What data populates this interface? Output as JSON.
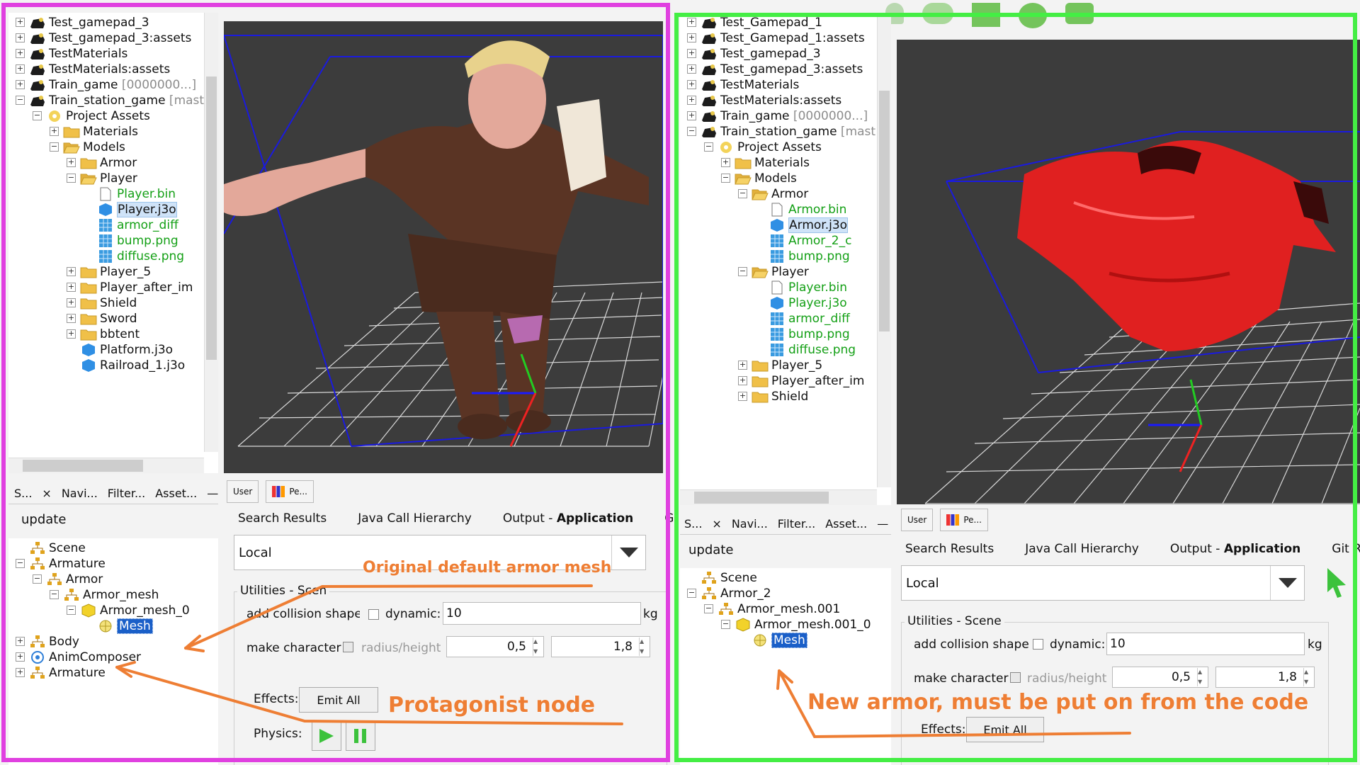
{
  "left": {
    "tree_rows": [
      {
        "label": "Test_gamepad_3",
        "icon": "gamepad-project-icon",
        "indent": 0,
        "expander": "+"
      },
      {
        "label": "Test_gamepad_3:assets",
        "icon": "gamepad-project-icon",
        "indent": 0,
        "expander": "+"
      },
      {
        "label": "TestMaterials",
        "icon": "gamepad-project-icon",
        "indent": 0,
        "expander": "+"
      },
      {
        "label": "TestMaterials:assets",
        "icon": "gamepad-project-icon",
        "indent": 0,
        "expander": "+"
      },
      {
        "label": "Train_game",
        "gray": " [0000000...]",
        "icon": "gamepad-project-icon",
        "indent": 0,
        "expander": "+"
      },
      {
        "label": "Train_station_game",
        "gray": " [mast",
        "icon": "gamepad-project-icon",
        "indent": 0,
        "expander": "-"
      },
      {
        "label": "Project Assets",
        "icon": "assets-icon",
        "indent": 1,
        "expander": "-"
      },
      {
        "label": "Materials",
        "icon": "folder-icon",
        "indent": 2,
        "expander": "+"
      },
      {
        "label": "Models",
        "icon": "folder-open-icon",
        "indent": 2,
        "expander": "-"
      },
      {
        "label": "Armor",
        "icon": "folder-icon",
        "indent": 3,
        "expander": "+"
      },
      {
        "label": "Player",
        "icon": "folder-open-icon",
        "indent": 3,
        "expander": "-"
      },
      {
        "label": "Player.bin",
        "icon": "file-icon",
        "indent": 4,
        "expander": "",
        "green": true
      },
      {
        "label": "Player.j3o",
        "icon": "model-cube-icon",
        "indent": 4,
        "expander": "",
        "selected": true
      },
      {
        "label": "armor_diff",
        "icon": "image-file-icon",
        "indent": 4,
        "expander": "",
        "green": true
      },
      {
        "label": "bump.png",
        "icon": "image-file-icon",
        "indent": 4,
        "expander": "",
        "green": true
      },
      {
        "label": "diffuse.png",
        "icon": "image-file-icon",
        "indent": 4,
        "expander": "",
        "green": true
      },
      {
        "label": "Player_5",
        "icon": "folder-icon",
        "indent": 3,
        "expander": "+"
      },
      {
        "label": "Player_after_im",
        "icon": "folder-icon",
        "indent": 3,
        "expander": "+"
      },
      {
        "label": "Shield",
        "icon": "folder-icon",
        "indent": 3,
        "expander": "+"
      },
      {
        "label": "Sword",
        "icon": "folder-icon",
        "indent": 3,
        "expander": "+"
      },
      {
        "label": "bbtent",
        "icon": "folder-icon",
        "indent": 3,
        "expander": "+"
      },
      {
        "label": "Platform.j3o",
        "icon": "model-cube-icon",
        "indent": 3,
        "expander": ""
      },
      {
        "label": "Railroad_1.j3o",
        "icon": "model-cube-icon",
        "indent": 3,
        "expander": ""
      }
    ],
    "panel_tabs": [
      "S...",
      "×",
      "Navi...",
      "Filter...",
      "Asset...",
      "—"
    ],
    "update_label": "update",
    "scene_rows": [
      {
        "label": "Scene",
        "icon": "scene-node-icon",
        "indent": 0,
        "expander": ""
      },
      {
        "label": "Armature",
        "icon": "node-icon",
        "indent": 0,
        "expander": "-"
      },
      {
        "label": "Armor",
        "icon": "node-icon",
        "indent": 1,
        "expander": "-"
      },
      {
        "label": "Armor_mesh",
        "icon": "node-icon",
        "indent": 2,
        "expander": "-"
      },
      {
        "label": "Armor_mesh_0",
        "icon": "geometry-cube-icon",
        "indent": 3,
        "expander": "-"
      },
      {
        "label": "Mesh",
        "icon": "mesh-icon",
        "indent": 4,
        "expander": "",
        "selected": true
      },
      {
        "label": "Body",
        "icon": "node-icon",
        "indent": 0,
        "expander": "+"
      },
      {
        "label": "AnimComposer",
        "icon": "anim-control-icon",
        "indent": 0,
        "expander": "+"
      },
      {
        "label": "Armature",
        "icon": "skeleton-icon",
        "indent": 0,
        "expander": "+"
      }
    ],
    "toolbar": {
      "user_label": "User",
      "pe_label": "Pe..."
    },
    "output_tabs": [
      "Search Results",
      "Java Call Hierarchy",
      "Output - ",
      "Git"
    ],
    "output_app": "Application",
    "combo_value": "Local",
    "utilities_title": "Utilities - Scen",
    "collision_label": "add collision shape",
    "dynamic_label": "dynamic:",
    "dynamic_value": "10",
    "kg": "kg",
    "make_character": "make character",
    "radius_label": "radius/height",
    "radius_value": "0,5",
    "height_value": "1,8",
    "effects_label": "Effects:",
    "emit_all": "Emit All",
    "physics_label": "Physics:"
  },
  "right": {
    "tree_rows": [
      {
        "label": "Test_Gamepad_1",
        "icon": "gamepad-project-icon",
        "indent": 0,
        "expander": "+"
      },
      {
        "label": "Test_Gamepad_1:assets",
        "icon": "gamepad-project-icon",
        "indent": 0,
        "expander": "+"
      },
      {
        "label": "Test_gamepad_3",
        "icon": "gamepad-project-icon",
        "indent": 0,
        "expander": "+"
      },
      {
        "label": "Test_gamepad_3:assets",
        "icon": "gamepad-project-icon",
        "indent": 0,
        "expander": "+"
      },
      {
        "label": "TestMaterials",
        "icon": "gamepad-project-icon",
        "indent": 0,
        "expander": "+"
      },
      {
        "label": "TestMaterials:assets",
        "icon": "gamepad-project-icon",
        "indent": 0,
        "expander": "+"
      },
      {
        "label": "Train_game",
        "gray": " [0000000...]",
        "icon": "gamepad-project-icon",
        "indent": 0,
        "expander": "+"
      },
      {
        "label": "Train_station_game",
        "gray": " [mast",
        "icon": "gamepad-project-icon",
        "indent": 0,
        "expander": "-"
      },
      {
        "label": "Project Assets",
        "icon": "assets-icon",
        "indent": 1,
        "expander": "-"
      },
      {
        "label": "Materials",
        "icon": "folder-icon",
        "indent": 2,
        "expander": "+"
      },
      {
        "label": "Models",
        "icon": "folder-open-icon",
        "indent": 2,
        "expander": "-"
      },
      {
        "label": "Armor",
        "icon": "folder-open-icon",
        "indent": 3,
        "expander": "-"
      },
      {
        "label": "Armor.bin",
        "icon": "file-icon",
        "indent": 4,
        "expander": "",
        "green": true
      },
      {
        "label": "Armor.j3o",
        "icon": "model-cube-icon",
        "indent": 4,
        "expander": "",
        "selected": true
      },
      {
        "label": "Armor_2_c",
        "icon": "image-file-icon",
        "indent": 4,
        "expander": "",
        "green": true
      },
      {
        "label": "bump.png",
        "icon": "image-file-icon",
        "indent": 4,
        "expander": "",
        "green": true
      },
      {
        "label": "Player",
        "icon": "folder-open-icon",
        "indent": 3,
        "expander": "-"
      },
      {
        "label": "Player.bin",
        "icon": "file-icon",
        "indent": 4,
        "expander": "",
        "green": true
      },
      {
        "label": "Player.j3o",
        "icon": "model-cube-icon",
        "indent": 4,
        "expander": "",
        "green": true
      },
      {
        "label": "armor_diff",
        "icon": "image-file-icon",
        "indent": 4,
        "expander": "",
        "green": true
      },
      {
        "label": "bump.png",
        "icon": "image-file-icon",
        "indent": 4,
        "expander": "",
        "green": true
      },
      {
        "label": "diffuse.png",
        "icon": "image-file-icon",
        "indent": 4,
        "expander": "",
        "green": true
      },
      {
        "label": "Player_5",
        "icon": "folder-icon",
        "indent": 3,
        "expander": "+"
      },
      {
        "label": "Player_after_im",
        "icon": "folder-icon",
        "indent": 3,
        "expander": "+"
      },
      {
        "label": "Shield",
        "icon": "folder-icon",
        "indent": 3,
        "expander": "+"
      }
    ],
    "panel_tabs": [
      "S...",
      "×",
      "Navi...",
      "Filter...",
      "Asset...",
      "—"
    ],
    "update_label": "update",
    "scene_rows": [
      {
        "label": "Scene",
        "icon": "scene-node-icon",
        "indent": 0,
        "expander": ""
      },
      {
        "label": "Armor_2",
        "icon": "node-icon",
        "indent": 0,
        "expander": "-"
      },
      {
        "label": "Armor_mesh.001",
        "icon": "node-icon",
        "indent": 1,
        "expander": "-"
      },
      {
        "label": "Armor_mesh.001_0",
        "icon": "geometry-cube-icon",
        "indent": 2,
        "expander": "-"
      },
      {
        "label": "Mesh",
        "icon": "mesh-icon",
        "indent": 3,
        "expander": "",
        "selected": true
      }
    ],
    "toolbar": {
      "user_label": "User",
      "pe_label": "Pe..."
    },
    "output_tabs": [
      "Search Results",
      "Java Call Hierarchy",
      "Output - ",
      "Git Rep"
    ],
    "output_app": "Application",
    "combo_value": "Local",
    "utilities_title": "Utilities - Scene",
    "collision_label": "add collision shape",
    "dynamic_label": "dynamic:",
    "dynamic_value": "10",
    "kg": "kg",
    "make_character": "make character",
    "radius_label": "radius/height",
    "radius_value": "0,5",
    "height_value": "1,8",
    "effects_label": "Effects:",
    "emit_all": "Emit All"
  },
  "annotations": {
    "original_armor": "Original default armor mesh",
    "protagonist": "Protagonist node",
    "new_armor": "New armor, must be put on from the code"
  },
  "colors": {
    "left_frame": "#e040e0",
    "right_frame": "#44ee44",
    "annotation": "#ee7e34",
    "viewport_bg": "#3c3c3c",
    "armor_red": "#e02020",
    "character_brown": "#5a3424"
  }
}
